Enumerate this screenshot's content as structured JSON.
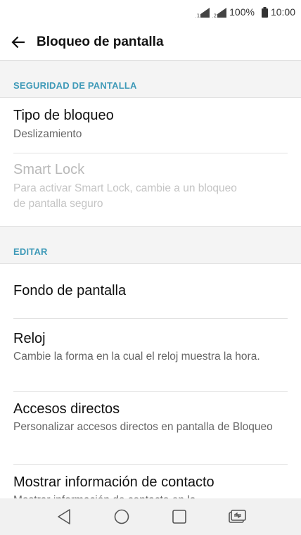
{
  "status_bar": {
    "battery_percent": "100%",
    "time": "10:00"
  },
  "app_bar": {
    "title": "Bloqueo de pantalla"
  },
  "sections": [
    {
      "header": "SEGURIDAD DE PANTALLA",
      "items": [
        {
          "title": "Tipo de bloqueo",
          "subtitle": "Deslizamiento",
          "enabled": true
        },
        {
          "title": "Smart Lock",
          "subtitle": "Para activar Smart Lock, cambie a un bloqueo de pantalla seguro",
          "enabled": false
        }
      ]
    },
    {
      "header": "EDITAR",
      "items": [
        {
          "title": "Fondo de pantalla",
          "subtitle": "",
          "enabled": true
        },
        {
          "title": "Reloj",
          "subtitle": "Cambie la forma en la cual el reloj muestra la hora.",
          "enabled": true
        },
        {
          "title": "Accesos directos",
          "subtitle": "Personalizar accesos directos en pantalla de Bloqueo",
          "enabled": true
        },
        {
          "title": "Mostrar información de contacto",
          "subtitle": "Mostrar información de contacto en la",
          "enabled": true
        }
      ]
    }
  ],
  "colors": {
    "section_header_text": "#3f9ab8",
    "section_header_bg": "#f4f4f4",
    "nav_bar_bg": "#f1f1f1"
  },
  "nav_bar": {
    "icons": [
      "back-triangle-icon",
      "home-circle-icon",
      "recents-square-icon",
      "dual-window-icon"
    ]
  }
}
